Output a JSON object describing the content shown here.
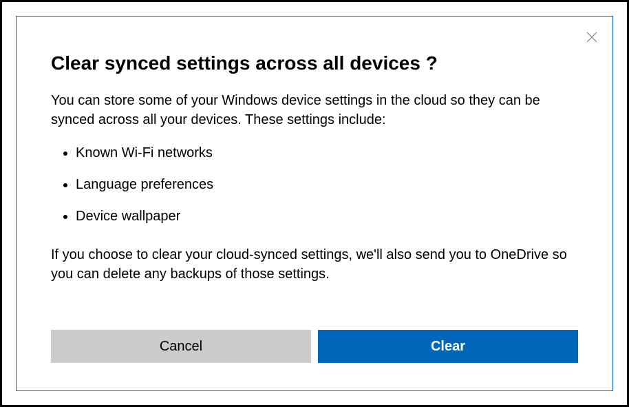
{
  "dialog": {
    "title": "Clear synced settings across all devices ?",
    "intro_text": "You can store some of your Windows device settings in the cloud so they can be synced across all your devices. These settings include:",
    "settings_items": [
      "Known Wi-Fi networks",
      "Language preferences",
      "Device wallpaper"
    ],
    "footer_text": "If you choose to clear your cloud-synced settings, we'll also send you to OneDrive so you can delete any backups of those settings.",
    "cancel_label": "Cancel",
    "clear_label": "Clear"
  }
}
